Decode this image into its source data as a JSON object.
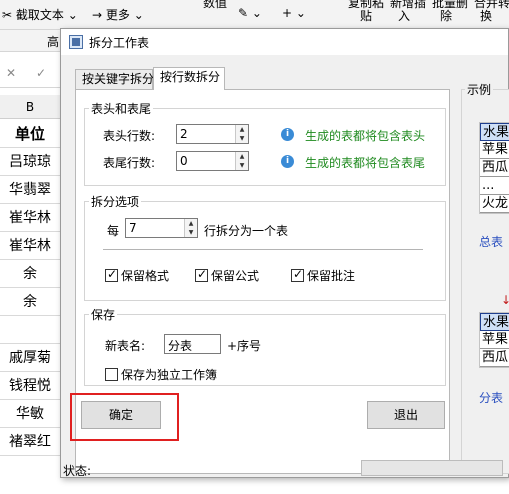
{
  "spreadsheet": {
    "ribbon": {
      "capture_text": "截取文本",
      "more": "更多",
      "values": "数值",
      "copy_paste_line1": "复制粘",
      "copy_paste_line2": "贴",
      "insert_line1": "新增插",
      "insert_line2": "入",
      "batch_delete_line1": "批量删",
      "batch_delete_line2": "除",
      "merge_replace_line1": "合并转",
      "merge_replace_line2": "换",
      "row2_fragment": "高"
    },
    "column_header": "B",
    "cells": [
      "单位",
      "吕琼琼",
      "华翡翠",
      "崔华林",
      "崔华林",
      "余",
      "余",
      "",
      "戚厚菊",
      "钱程悦",
      "华敏",
      "褚翠红"
    ]
  },
  "dialog": {
    "title": "拆分工作表",
    "tabs": [
      {
        "label": "按关键字拆分",
        "active": false
      },
      {
        "label": "按行数拆分",
        "active": true
      }
    ],
    "header_footer": {
      "title": "表头和表尾",
      "header_rows_label": "表头行数:",
      "header_rows_value": "2",
      "header_hint": "生成的表都将包含表头",
      "footer_rows_label": "表尾行数:",
      "footer_rows_value": "0",
      "footer_hint": "生成的表都将包含表尾"
    },
    "split_options": {
      "title": "拆分选项",
      "every_label": "每",
      "rows_value": "7",
      "rows_suffix": "行拆分为一个表",
      "keep_format": {
        "label": "保留格式",
        "checked": true
      },
      "keep_formula": {
        "label": "保留公式",
        "checked": true
      },
      "keep_comments": {
        "label": "保留批注",
        "checked": true
      }
    },
    "save": {
      "title": "保存",
      "new_name_label": "新表名:",
      "new_name_value": "分表",
      "name_suffix": "+序号",
      "save_workbook": {
        "label": "保存为独立工作簿",
        "checked": false
      }
    },
    "ok_button": "确定",
    "exit_button": "退出",
    "status_label": "状态:",
    "example": {
      "title": "示例",
      "card1": [
        "水果",
        "苹果",
        "西瓜",
        "...",
        "火龙"
      ],
      "card1_footer": "总表",
      "card2": [
        "水果",
        "苹果",
        "西瓜"
      ],
      "card2_footer": "分表"
    }
  },
  "colors": {
    "hint": "#1f8a1f",
    "highlight": "#e02020",
    "info": "#3a8bd6",
    "link": "#2a4fbf"
  }
}
